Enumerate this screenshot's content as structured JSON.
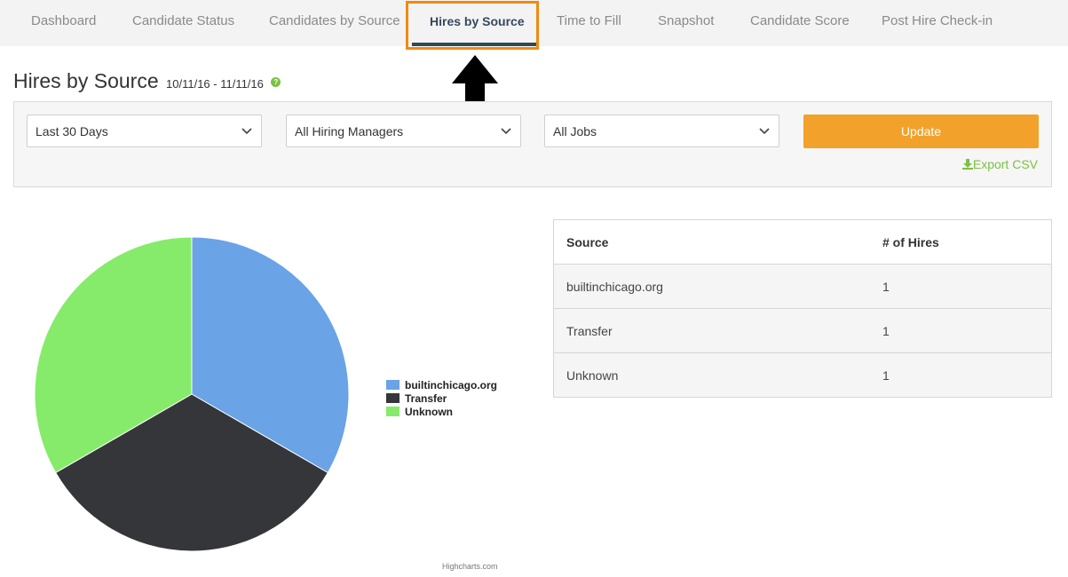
{
  "tabs": [
    {
      "label": "Dashboard"
    },
    {
      "label": "Candidate Status"
    },
    {
      "label": "Candidates by Source"
    },
    {
      "label": "Hires by Source",
      "active": true
    },
    {
      "label": "Time to Fill"
    },
    {
      "label": "Snapshot"
    },
    {
      "label": "Candidate Score"
    },
    {
      "label": "Post Hire Check-in"
    }
  ],
  "header": {
    "title": "Hires by Source",
    "date_range": "10/11/16 - 11/11/16",
    "help_icon": "question-circle-icon"
  },
  "filters": {
    "period": "Last 30 Days",
    "hiring_manager": "All Hiring Managers",
    "jobs": "All Jobs",
    "update_label": "Update",
    "export_label": "Export CSV"
  },
  "table": {
    "headers": [
      "Source",
      "# of Hires"
    ],
    "rows": [
      [
        "builtinchicago.org",
        "1"
      ],
      [
        "Transfer",
        "1"
      ],
      [
        "Unknown",
        "1"
      ]
    ]
  },
  "chart_data": {
    "type": "pie",
    "categories": [
      "builtinchicago.org",
      "Transfer",
      "Unknown"
    ],
    "values": [
      1,
      1,
      1
    ],
    "colors": [
      "#6aa3e6",
      "#35363a",
      "#86eb6a"
    ],
    "legend": "right"
  },
  "credits": "Highcharts.com",
  "colors": {
    "accent": "#f2a22a",
    "highlight": "#f08a12",
    "green": "#7bc142"
  }
}
